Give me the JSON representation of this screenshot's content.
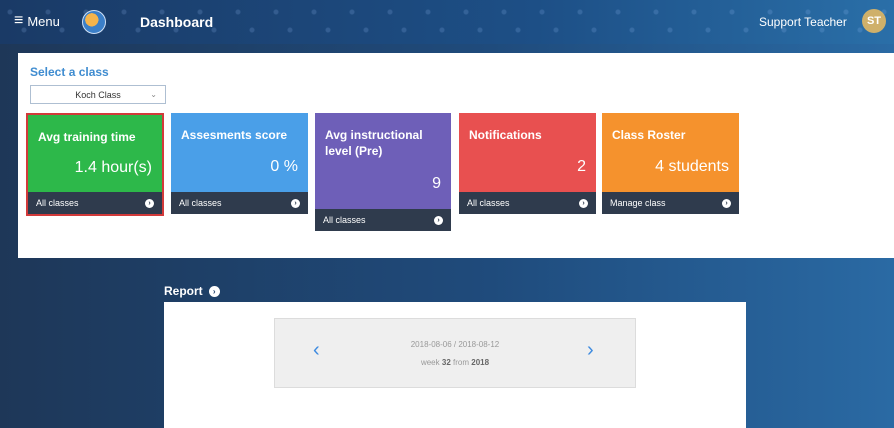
{
  "topbar": {
    "menu_label": "Menu",
    "title": "Dashboard",
    "user_name": "Support Teacher",
    "avatar_initials": "ST"
  },
  "class_selector": {
    "label": "Select a class",
    "selected": "Koch Class"
  },
  "cards": [
    {
      "title": "Avg training time",
      "value": "1.4 hour(s)",
      "footer": "All classes",
      "color": "#2db84a",
      "selected": true
    },
    {
      "title": "Assesments score",
      "value": "0 %",
      "footer": "All classes",
      "color": "#4a9fe8"
    },
    {
      "title": "Avg instructional level (Pre)",
      "value": "9",
      "footer": "All classes",
      "color": "#6e5fb8"
    },
    {
      "title": "Notifications",
      "value": "2",
      "footer": "All classes",
      "color": "#e85050"
    },
    {
      "title": "Class Roster",
      "value": "4 students",
      "footer": "Manage class",
      "color": "#f5922d"
    }
  ],
  "report": {
    "label": "Report",
    "week_range": "2018-08-06 / 2018-08-12",
    "week_prefix": "week",
    "week_number": "32",
    "week_mid": "from",
    "year": "2018"
  },
  "icons": {
    "menu": "hamburger-icon",
    "card_arrow": "chevron-circle-right-icon",
    "prev": "chevron-left-icon",
    "next": "chevron-right-icon"
  }
}
